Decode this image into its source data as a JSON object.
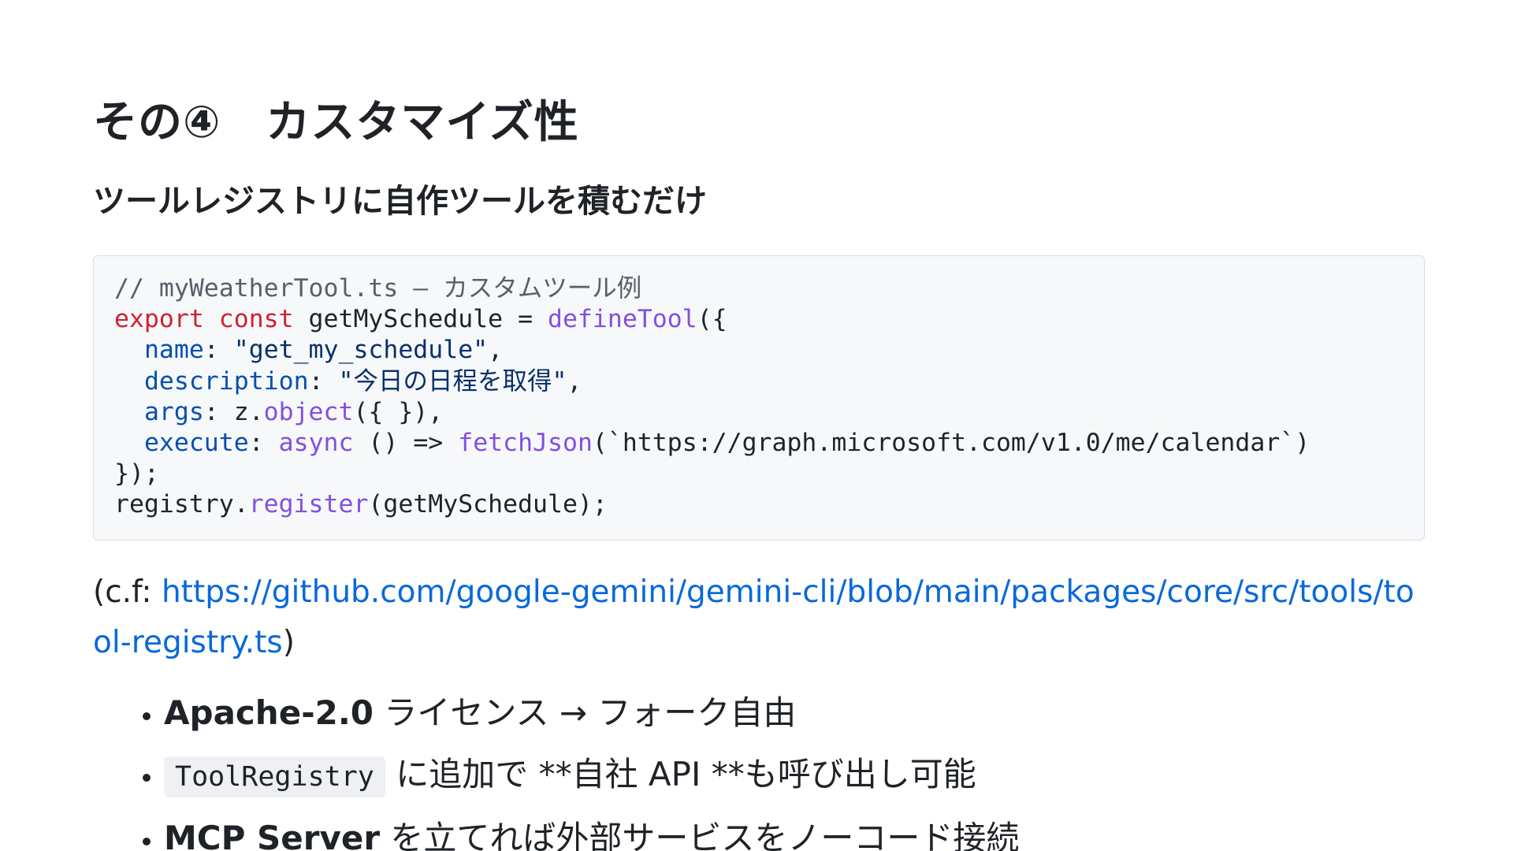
{
  "heading": {
    "title": "その④　カスタマイズ性",
    "subtitle": "ツールレジストリに自作ツールを積むだけ"
  },
  "code": {
    "comment": "// myWeatherTool.ts – カスタムツール例",
    "l2_kw1": "export",
    "l2_kw2": "const",
    "l2_name": " getMySchedule = ",
    "l2_fn": "defineTool",
    "l2_end": "({",
    "l3_prop": "name",
    "l3_colon": ": ",
    "l3_str": "\"get_my_schedule\"",
    "l3_end": ",",
    "l4_prop": "description",
    "l4_colon": ": ",
    "l4_str": "\"今日の日程を取得\"",
    "l4_end": ",",
    "l5_prop": "args",
    "l5_mid": ": z.",
    "l5_fn": "object",
    "l5_end": "({ }),",
    "l6_prop": "execute",
    "l6_colon": ": ",
    "l6_kw": "async",
    "l6_arrow": " () => ",
    "l6_fn": "fetchJson",
    "l6_end": "(`https://graph.microsoft.com/v1.0/me/calendar`)",
    "l7": "});",
    "l8_obj": "registry.",
    "l8_fn": "register",
    "l8_end": "(getMySchedule);"
  },
  "reference": {
    "prefix": "(c.f: ",
    "link_text": "https://github.com/google-gemini/gemini-cli/blob/main/packages/core/src/tools/tool-registry.ts",
    "suffix": ")"
  },
  "bullets": [
    {
      "strong": "Apache-2.0",
      "text": " ライセンス → フォーク自由"
    },
    {
      "code": "ToolRegistry",
      "text": " に追加で **自社 API **も呼び出し可能"
    },
    {
      "strong": "MCP Server",
      "text": " を立てれば外部サービスをノーコード接続"
    }
  ],
  "colors": {
    "keyword": "#cf222e",
    "function": "#8250df",
    "property": "#0550ae",
    "string": "#0a3069",
    "comment": "#57606a",
    "link": "#0969da"
  }
}
